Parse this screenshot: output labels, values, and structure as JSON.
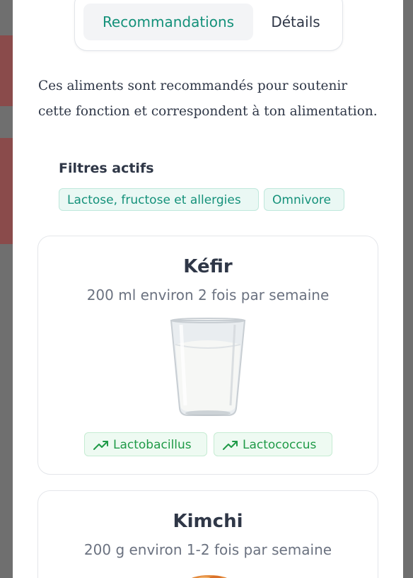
{
  "tabs": [
    {
      "label": "Recommandations",
      "active": true
    },
    {
      "label": "Détails",
      "active": false
    }
  ],
  "intro_text": "Ces aliments sont recommandés pour soutenir cette fonction et correspondent à ton alimentation.",
  "filters": {
    "title": "Filtres actifs",
    "chips": [
      "Lactose, fructose et allergies",
      "Omnivore"
    ]
  },
  "foods": [
    {
      "name": "Kéfir",
      "portion": "200 ml environ 2 fois par semaine",
      "tags": [
        {
          "label": "Lactobacillus",
          "icon": "trending-up-icon"
        },
        {
          "label": "Lactococcus",
          "icon": "trending-up-icon"
        }
      ]
    },
    {
      "name": "Kimchi",
      "portion": "200 g environ 1-2 fois par semaine"
    }
  ],
  "colors": {
    "accent": "#14917a",
    "tag_green": "#1f9a47",
    "text": "#2f3747",
    "muted": "#6b7280"
  }
}
